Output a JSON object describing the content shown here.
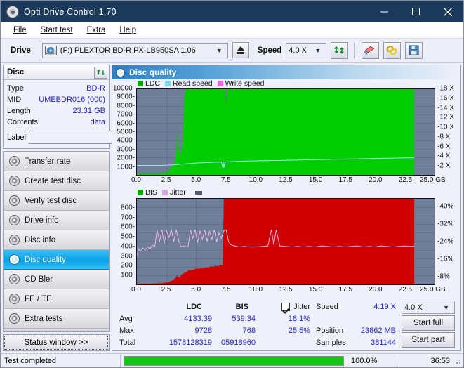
{
  "window": {
    "title": "Opti Drive Control 1.70",
    "icon": "disc-icon",
    "minimize": "minimize-icon",
    "maximize": "maximize-icon",
    "close": "close-icon"
  },
  "menu": [
    {
      "label": "File",
      "accel": "F"
    },
    {
      "label": "Start test",
      "accel": "S"
    },
    {
      "label": "Extra",
      "accel": "x"
    },
    {
      "label": "Help",
      "accel": "H"
    }
  ],
  "toolbar": {
    "drive_label": "Drive",
    "drive_value": "(F:)  PLEXTOR BD-R  PX-LB950SA 1.06",
    "eject_icon": "eject-icon",
    "speed_label": "Speed",
    "speed_value": "4.0 X",
    "refresh_icon": "refresh-icon",
    "erase_icon": "eraser-icon",
    "chain_icon": "chain-icon",
    "save_icon": "floppy-save-icon"
  },
  "disc_panel": {
    "title": "Disc",
    "refresh_icon": "refresh-icon",
    "rows": [
      {
        "key": "Type",
        "value": "BD-R"
      },
      {
        "key": "MID",
        "value": "UMEBDR016 (000)"
      },
      {
        "key": "Length",
        "value": "23.31 GB"
      },
      {
        "key": "Contents",
        "value": "data"
      }
    ],
    "label_key": "Label",
    "label_value": "",
    "label_placeholder": "",
    "label_button_icon": "cd-icon"
  },
  "nav": {
    "items": [
      {
        "label": "Transfer rate",
        "icon": "disc-icon",
        "selected": false
      },
      {
        "label": "Create test disc",
        "icon": "disc-icon",
        "selected": false
      },
      {
        "label": "Verify test disc",
        "icon": "disc-icon",
        "selected": false
      },
      {
        "label": "Drive info",
        "icon": "disc-icon",
        "selected": false
      },
      {
        "label": "Disc info",
        "icon": "disc-icon",
        "selected": false
      },
      {
        "label": "Disc quality",
        "icon": "disc-icon",
        "selected": true
      },
      {
        "label": "CD Bler",
        "icon": "disc-icon",
        "selected": false
      },
      {
        "label": "FE / TE",
        "icon": "disc-icon",
        "selected": false
      },
      {
        "label": "Extra tests",
        "icon": "disc-icon",
        "selected": false
      }
    ],
    "status_window_button": "Status window >>"
  },
  "content_header": {
    "title": "Disc quality",
    "icon": "disc-icon"
  },
  "stats": {
    "col_headers": [
      "LDC",
      "BIS"
    ],
    "rows": [
      {
        "label": "Avg",
        "ldc": "4133.39",
        "bis": "539.34",
        "jitter": "18.1%"
      },
      {
        "label": "Max",
        "ldc": "9728",
        "bis": "768",
        "jitter": "25.5%"
      },
      {
        "label": "Total",
        "ldc": "1578128319",
        "bis": "05918960",
        "jitter": ""
      }
    ],
    "jitter_label": "Jitter",
    "jitter_checked": true,
    "speed_label": "Speed",
    "speed_value": "4.19 X",
    "position_label": "Position",
    "position_value": "23862 MB",
    "samples_label": "Samples",
    "samples_value": "381144",
    "speed_select_value": "4.0 X",
    "start_full_button": "Start full",
    "start_part_button": "Start part"
  },
  "statusbar": {
    "message": "Test completed",
    "percent_label": "100.0%",
    "percent_value": 100,
    "elapsed": "36:53",
    "bar_color": "#15c415"
  },
  "chart_data": [
    {
      "id": "ldc-chart",
      "type": "area",
      "title": "",
      "xlabel": "GB",
      "ylabel": "",
      "xlim": [
        0,
        25
      ],
      "ylim": [
        0,
        10000
      ],
      "y2lim": [
        0,
        18
      ],
      "grid": true,
      "legend_position": "top-left",
      "legend": [
        {
          "name": "LDC",
          "color": "#00a800"
        },
        {
          "name": "Read speed",
          "color": "#7fd4f5"
        },
        {
          "name": "Write speed",
          "color": "#ff66dd"
        }
      ],
      "xticks": [
        "0.0",
        "2.5",
        "5.0",
        "7.5",
        "10.0",
        "12.5",
        "15.0",
        "17.5",
        "20.0",
        "22.5",
        "25.0 GB"
      ],
      "yticks": [
        "10000",
        "9000",
        "8000",
        "7000",
        "6000",
        "5000",
        "4000",
        "3000",
        "2000",
        "1000"
      ],
      "y2ticks": [
        "18 X",
        "16 X",
        "14 X",
        "12 X",
        "10 X",
        "8 X",
        "6 X",
        "4 X",
        "2 X"
      ],
      "series": [
        {
          "name": "LDC",
          "color": "#00cc00",
          "kind": "area",
          "x": [
            0.0,
            0.2,
            0.4,
            0.6,
            0.8,
            1.0,
            1.2,
            1.4,
            1.6,
            1.8,
            2.0,
            2.2,
            2.4,
            2.6,
            2.8,
            3.0,
            3.2,
            3.3,
            3.4,
            3.5,
            3.6,
            3.7,
            3.8,
            3.9,
            4.0,
            4.1,
            4.2,
            4.3,
            4.4,
            4.5,
            4.6,
            4.7,
            4.8,
            5.0,
            5.5,
            6.0,
            6.5,
            7.0,
            7.2,
            7.4,
            7.5,
            7.6,
            8.0,
            9.0,
            10.0,
            12.0,
            14.0,
            16.0,
            18.0,
            20.0,
            22.0,
            23.3
          ],
          "y": [
            60,
            150,
            180,
            160,
            200,
            170,
            190,
            210,
            180,
            200,
            230,
            260,
            300,
            420,
            700,
            1100,
            1600,
            2900,
            5200,
            3400,
            2200,
            2600,
            3500,
            6500,
            9300,
            10000,
            10000,
            10000,
            10000,
            10000,
            9900,
            10000,
            10000,
            10000,
            10000,
            10000,
            10000,
            10000,
            10000,
            10000,
            8200,
            10000,
            10000,
            10000,
            10000,
            10000,
            10000,
            10000,
            10000,
            10000,
            10000,
            10000
          ]
        },
        {
          "name": "Read speed",
          "color": "#9fe4fb",
          "kind": "line",
          "x": [
            0.0,
            0.5,
            1.0,
            1.5,
            2.0,
            2.5,
            3.0,
            3.5,
            4.0,
            4.5,
            5.0,
            5.5,
            6.0,
            6.5,
            7.0,
            7.1,
            7.2,
            7.25,
            7.3,
            7.4,
            7.6,
            8.0,
            9.0,
            10.0,
            11.0,
            12.0,
            13.0,
            14.0,
            15.0,
            16.0,
            17.0,
            18.0,
            19.0,
            20.0,
            21.0,
            22.0,
            23.0,
            23.3
          ],
          "y": [
            2.0,
            2.0,
            2.0,
            2.0,
            2.0,
            2.05,
            2.1,
            2.2,
            2.3,
            2.4,
            2.5,
            2.55,
            2.6,
            2.65,
            2.7,
            2.7,
            1.6,
            2.7,
            1.5,
            2.7,
            2.75,
            2.8,
            2.9,
            2.95,
            3.0,
            3.05,
            3.1,
            3.15,
            3.2,
            3.25,
            3.3,
            3.35,
            3.4,
            3.45,
            3.5,
            3.55,
            3.6,
            3.6
          ]
        },
        {
          "name": "Write speed",
          "color": "#ff66dd",
          "kind": "line",
          "x": [],
          "y": []
        }
      ]
    },
    {
      "id": "bis-jitter-chart",
      "type": "area",
      "title": "",
      "xlabel": "GB",
      "ylabel": "",
      "xlim": [
        0,
        25
      ],
      "ylim": [
        0,
        800
      ],
      "y2lim": [
        0,
        40
      ],
      "grid": true,
      "legend_position": "top-left",
      "legend": [
        {
          "name": "BIS",
          "color": "#00a800"
        },
        {
          "name": "Jitter",
          "color": "#dda8dd"
        }
      ],
      "xticks": [
        "0.0",
        "2.5",
        "5.0",
        "7.5",
        "10.0",
        "12.5",
        "15.0",
        "17.5",
        "20.0",
        "22.5",
        "25.0 GB"
      ],
      "yticks": [
        "800",
        "700",
        "600",
        "500",
        "400",
        "300",
        "200",
        "100"
      ],
      "y2ticks": [
        "40%",
        "32%",
        "24%",
        "16%",
        "8%"
      ],
      "series": [
        {
          "name": "BIS",
          "color": "#d00000",
          "kind": "area",
          "x": [
            0.0,
            0.5,
            1.0,
            1.5,
            2.0,
            2.3,
            2.6,
            2.8,
            3.0,
            3.2,
            3.4,
            3.5,
            3.6,
            3.8,
            4.0,
            4.2,
            4.4,
            4.6,
            4.8,
            5.0,
            5.2,
            5.4,
            5.6,
            5.8,
            6.0,
            6.2,
            6.4,
            6.6,
            6.8,
            7.0,
            7.1,
            7.2,
            7.3,
            7.4,
            8.0,
            10.0,
            12.0,
            14.0,
            16.0,
            18.0,
            20.0,
            22.0,
            23.3
          ],
          "y": [
            6,
            6,
            6,
            8,
            10,
            14,
            20,
            28,
            40,
            55,
            85,
            60,
            70,
            95,
            110,
            120,
            135,
            130,
            140,
            150,
            145,
            155,
            150,
            160,
            155,
            170,
            165,
            175,
            170,
            180,
            185,
            175,
            800,
            800,
            800,
            800,
            800,
            800,
            800,
            800,
            800,
            800,
            800
          ]
        },
        {
          "name": "Jitter",
          "color": "#e8b4e8",
          "kind": "line",
          "x": [
            0.0,
            0.15,
            0.3,
            0.5,
            0.7,
            0.9,
            1.1,
            1.3,
            1.5,
            1.7,
            1.9,
            2.1,
            2.3,
            2.5,
            2.7,
            2.9,
            3.1,
            3.3,
            3.5,
            3.7,
            3.9,
            4.1,
            4.3,
            4.5,
            4.7,
            4.9,
            5.1,
            5.3,
            5.5,
            5.7,
            5.9,
            6.1,
            6.3,
            6.5,
            6.7,
            6.9,
            7.1,
            7.3,
            7.5,
            7.7,
            7.9,
            8.2,
            8.6,
            9.0,
            9.5,
            10.0,
            10.5,
            11.0,
            11.3,
            11.5,
            11.7,
            12.0,
            12.5,
            13.0,
            13.5,
            14.0,
            14.5,
            15.0,
            15.5,
            16.0,
            16.5,
            17.0,
            17.5,
            18.0,
            18.5,
            19.0,
            19.5,
            20.0,
            20.5,
            21.0,
            21.5,
            22.0,
            22.5,
            23.0,
            23.3
          ],
          "y": [
            270,
            330,
            310,
            340,
            320,
            350,
            330,
            370,
            350,
            510,
            400,
            510,
            380,
            500,
            440,
            510,
            400,
            510,
            420,
            350,
            360,
            355,
            350,
            510,
            430,
            510,
            390,
            500,
            420,
            510,
            400,
            500,
            420,
            510,
            400,
            480,
            430,
            500,
            510,
            400,
            370,
            360,
            350,
            355,
            350,
            350,
            355,
            360,
            510,
            370,
            510,
            360,
            355,
            350,
            355,
            350,
            355,
            350,
            360,
            355,
            350,
            355,
            350,
            355,
            360,
            350,
            355,
            350,
            360,
            355,
            350,
            355,
            360,
            355,
            360
          ]
        }
      ]
    }
  ]
}
